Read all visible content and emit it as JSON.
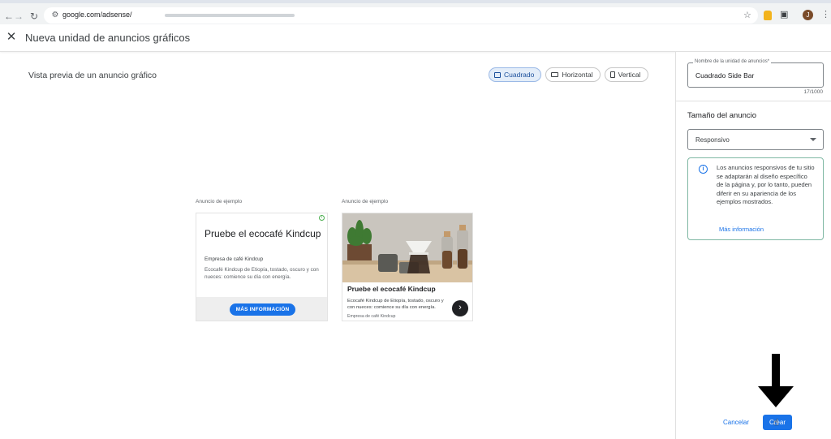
{
  "browser": {
    "url": "google.com/adsense/",
    "avatar_initial": "J"
  },
  "header": {
    "title": "Nueva unidad de anuncios gráficos"
  },
  "preview": {
    "label": "Vista previa de un anuncio gráfico",
    "formats": [
      {
        "label": "Cuadrado",
        "selected": true
      },
      {
        "label": "Horizontal",
        "selected": false
      },
      {
        "label": "Vertical",
        "selected": false
      }
    ]
  },
  "ads": [
    {
      "sample_label": "Anuncio de ejemplo",
      "headline": "Pruebe el ecocafé Kindcup",
      "advertiser": "Empresa de café Kindcup",
      "body": "Ecocafé Kindcup de Etiopía, tostado, oscuro y con nueces: comience su día con energía.",
      "cta": "MÁS INFORMACIÓN"
    },
    {
      "sample_label": "Anuncio de ejemplo",
      "headline": "Pruebe el ecocafé Kindcup",
      "body": "Ecocafé Kindcup de Etiopía, tostado, oscuro y con nueces: comience su día con energía.",
      "advertiser": "Empresa de café Kindcup"
    }
  ],
  "panel": {
    "name_label": "Nombre de la unidad de anuncios*",
    "name_value": "Cuadrado Side Bar",
    "counter": "17/1000",
    "size_title": "Tamaño del anuncio",
    "size_value": "Responsivo",
    "info_text": "Los anuncios responsivos de tu sitio se adaptarán al diseño específico de la página y, por lo tanto, pueden diferir en su apariencia de los ejemplos mostrados.",
    "info_link": "Más información",
    "cancel_label": "Cancelar",
    "create_label": "Crear"
  },
  "colors": {
    "primary": "#1a73e8",
    "chip_active_bg": "#e3edf9",
    "info_border": "#7fb8a3"
  }
}
